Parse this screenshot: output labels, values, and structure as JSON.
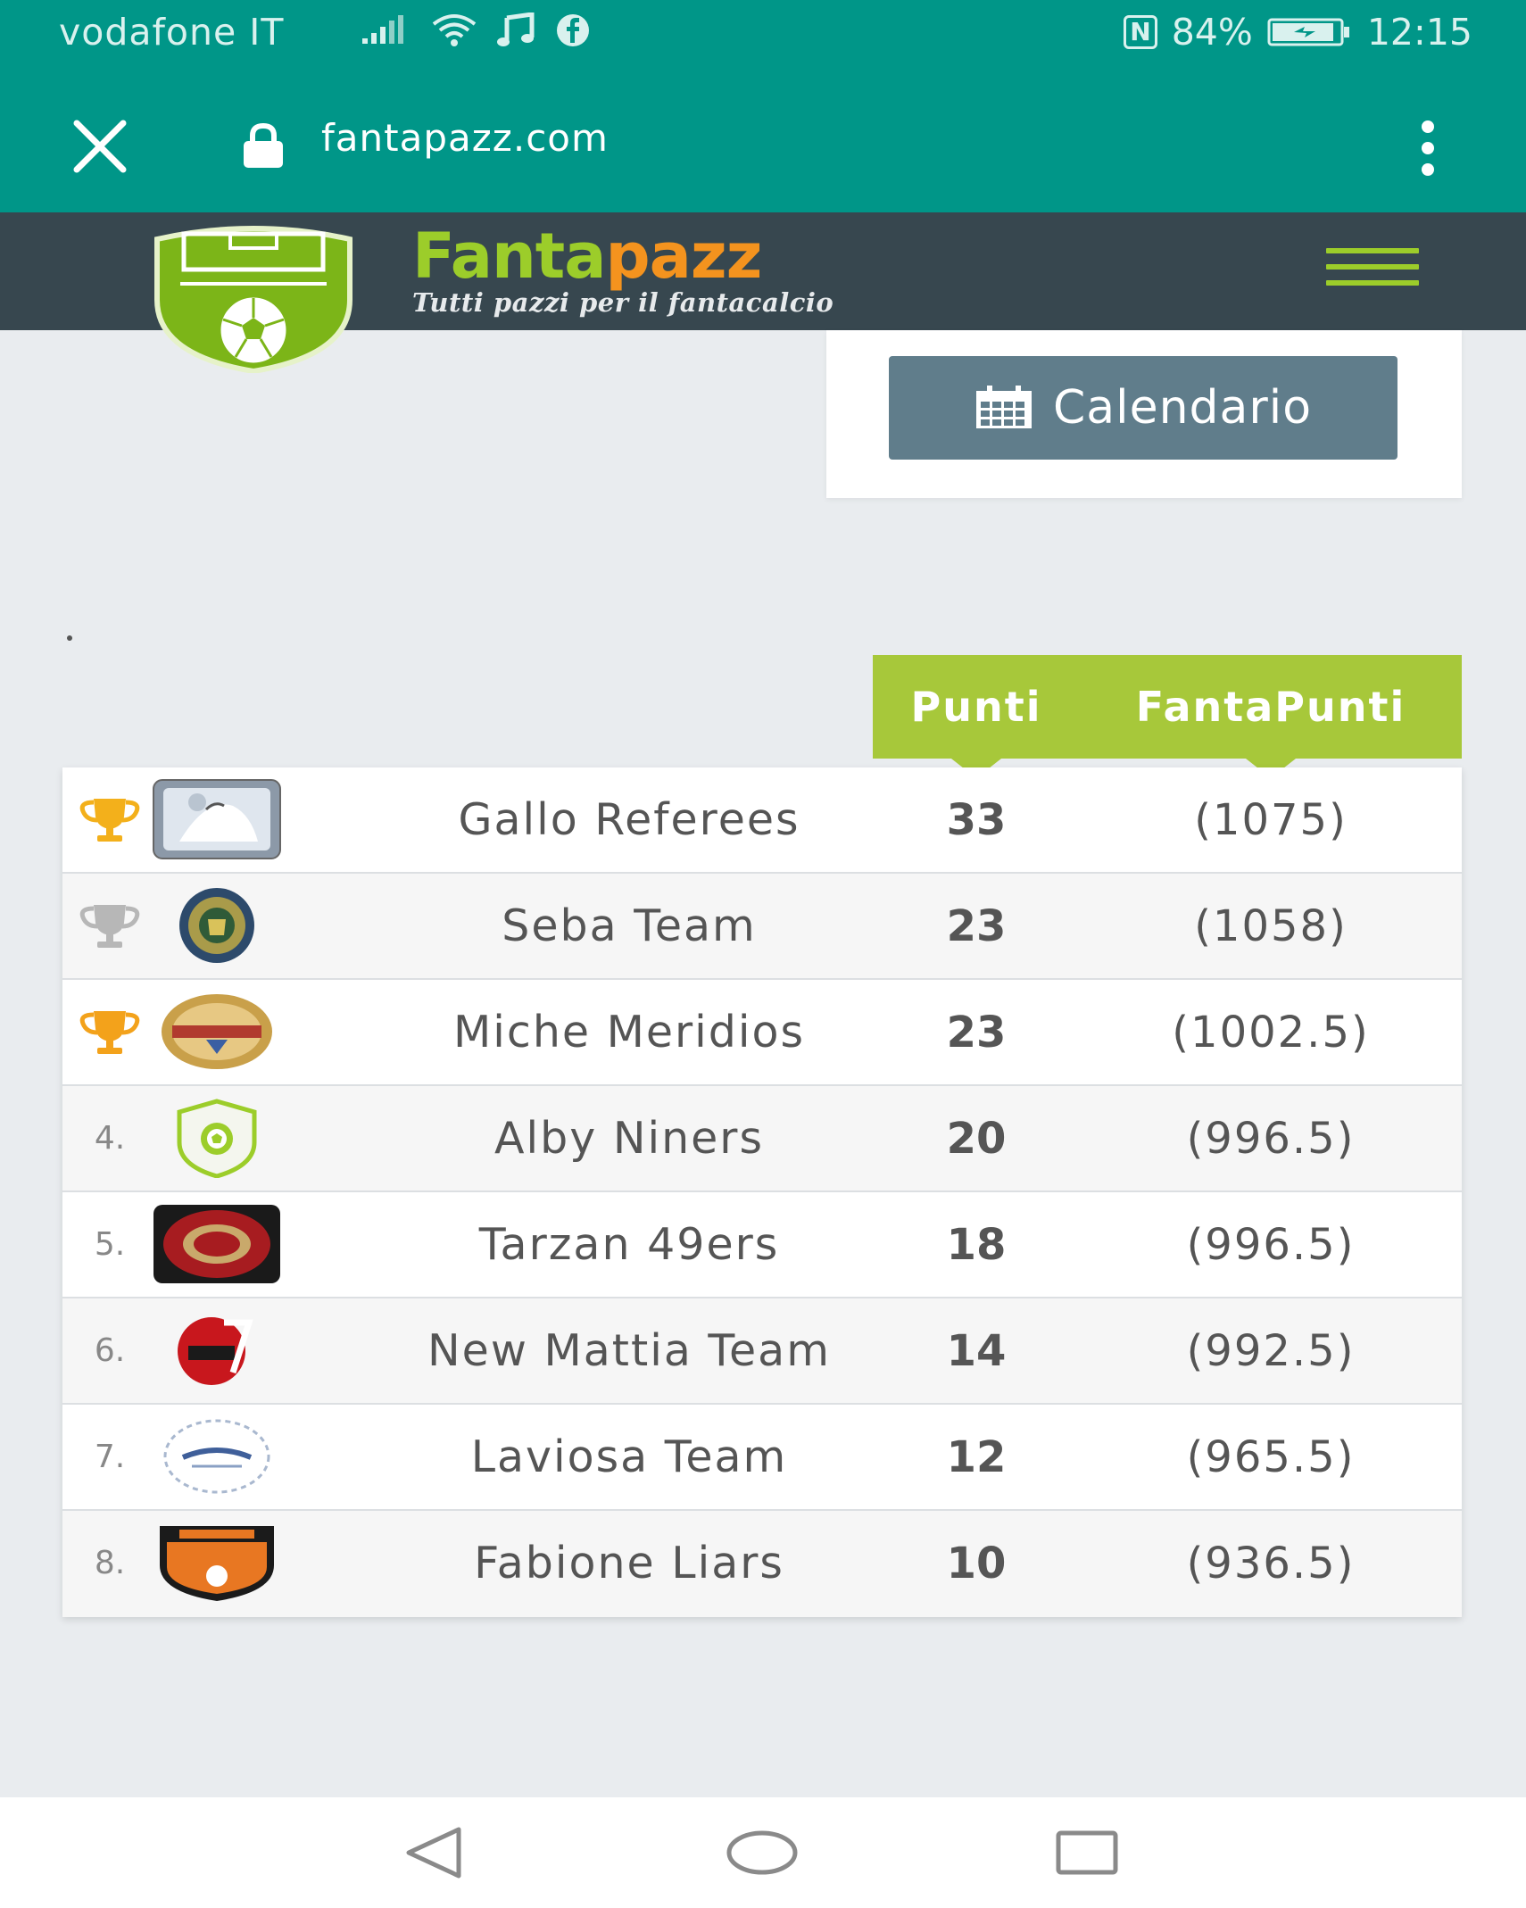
{
  "status_bar": {
    "carrier": "vodafone IT",
    "nfc": "N",
    "battery": "84%",
    "time": "12:15"
  },
  "browser": {
    "url": "fantapazz.com",
    "icons": [
      "close-icon",
      "lock-icon",
      "more-vert-icon"
    ]
  },
  "site": {
    "brand_part1": "Fanta",
    "brand_part2": "pazz",
    "tagline": "Tutti pazzi per il fantacalcio",
    "colors": {
      "header_bg": "#37474f",
      "brand_green": "#9ccd2a",
      "brand_orange": "#f4931e",
      "accent": "#a7c83a"
    }
  },
  "calendar_button": {
    "label": "Calendario",
    "icon": "calendar-icon"
  },
  "standings": {
    "headers": {
      "points": "Punti",
      "fanta_points": "FantaPunti"
    },
    "rows": [
      {
        "rank": "",
        "marker": "trophy-gold",
        "team": "Gallo Referees",
        "points": "33",
        "fanta_points": "(1075)"
      },
      {
        "rank": "",
        "marker": "trophy-silver",
        "team": "Seba Team",
        "points": "23",
        "fanta_points": "(1058)"
      },
      {
        "rank": "",
        "marker": "trophy-bronze",
        "team": "Miche Meridios",
        "points": "23",
        "fanta_points": "(1002.5)"
      },
      {
        "rank": "4.",
        "marker": "",
        "team": "Alby Niners",
        "points": "20",
        "fanta_points": "(996.5)"
      },
      {
        "rank": "5.",
        "marker": "",
        "team": "Tarzan 49ers",
        "points": "18",
        "fanta_points": "(996.5)"
      },
      {
        "rank": "6.",
        "marker": "",
        "team": "New Mattia Team",
        "points": "14",
        "fanta_points": "(992.5)"
      },
      {
        "rank": "7.",
        "marker": "",
        "team": "Laviosa Team",
        "points": "12",
        "fanta_points": "(965.5)"
      },
      {
        "rank": "8.",
        "marker": "",
        "team": "Fabione Liars",
        "points": "10",
        "fanta_points": "(936.5)"
      }
    ]
  }
}
